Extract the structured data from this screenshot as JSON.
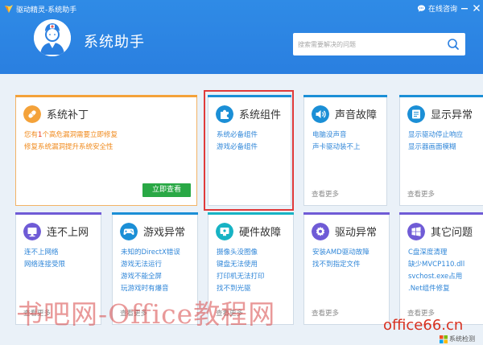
{
  "window": {
    "title": "驱动精灵-系统助手",
    "consult_label": "在线咨询"
  },
  "header": {
    "title": "系统助手",
    "search_placeholder": "搜索需要解决的问题"
  },
  "cards": [
    {
      "title": "系统补丁",
      "icon": "patch-icon",
      "color": "#f4a23a",
      "links": [
        {
          "pre": "您有",
          "num": "1",
          "post": "个高危漏洞需要立即修复"
        },
        {
          "pre": "修复系统漏洞提升系统安全性",
          "num": "",
          "post": ""
        }
      ],
      "action_label": "立即查看"
    },
    {
      "title": "系统组件",
      "icon": "puzzle-icon",
      "color": "#1b8fd6",
      "links": [
        "系统必备组件",
        "游戏必备组件"
      ],
      "more": ""
    },
    {
      "title": "声音故障",
      "icon": "speaker-icon",
      "color": "#1b8fd6",
      "links": [
        "电脑没声音",
        "声卡驱动装不上"
      ],
      "more": "查看更多"
    },
    {
      "title": "显示异常",
      "icon": "display-icon",
      "color": "#1b8fd6",
      "links": [
        "显示驱动停止响应",
        "显示器画面模糊"
      ],
      "more": "查看更多"
    },
    {
      "title": "连不上网",
      "icon": "network-icon",
      "color": "#6f5bd6",
      "links": [
        "连不上网络",
        "网络连接受限"
      ],
      "more": "查看更多"
    },
    {
      "title": "游戏异常",
      "icon": "gamepad-icon",
      "color": "#1b8fd6",
      "links": [
        "未知的DirectX错误",
        "游戏无法运行",
        "游戏不能全屏",
        "玩游戏时有爆音"
      ],
      "more": "查看更多"
    },
    {
      "title": "硬件故障",
      "icon": "hardware-icon",
      "color": "#17b3c4",
      "links": [
        "摄像头没图像",
        "键盘无法使用",
        "打印机无法打印",
        "找不到光驱"
      ],
      "more": "查看更多"
    },
    {
      "title": "驱动异常",
      "icon": "gear-icon",
      "color": "#6f5bd6",
      "links": [
        "安装AMD驱动故障",
        "找不到指定文件"
      ],
      "more": "查看更多"
    },
    {
      "title": "其它问题",
      "icon": "windows-icon",
      "color": "#6f5bd6",
      "links": [
        "C盘深度清理",
        "缺少MVCP110.dll",
        "svchost.exe占用",
        ".Net组件修复"
      ],
      "more": "查看更多"
    }
  ],
  "watermark": {
    "text": "书吧网-Office教程网",
    "site": "office66.cn",
    "brand": "系统检测"
  }
}
